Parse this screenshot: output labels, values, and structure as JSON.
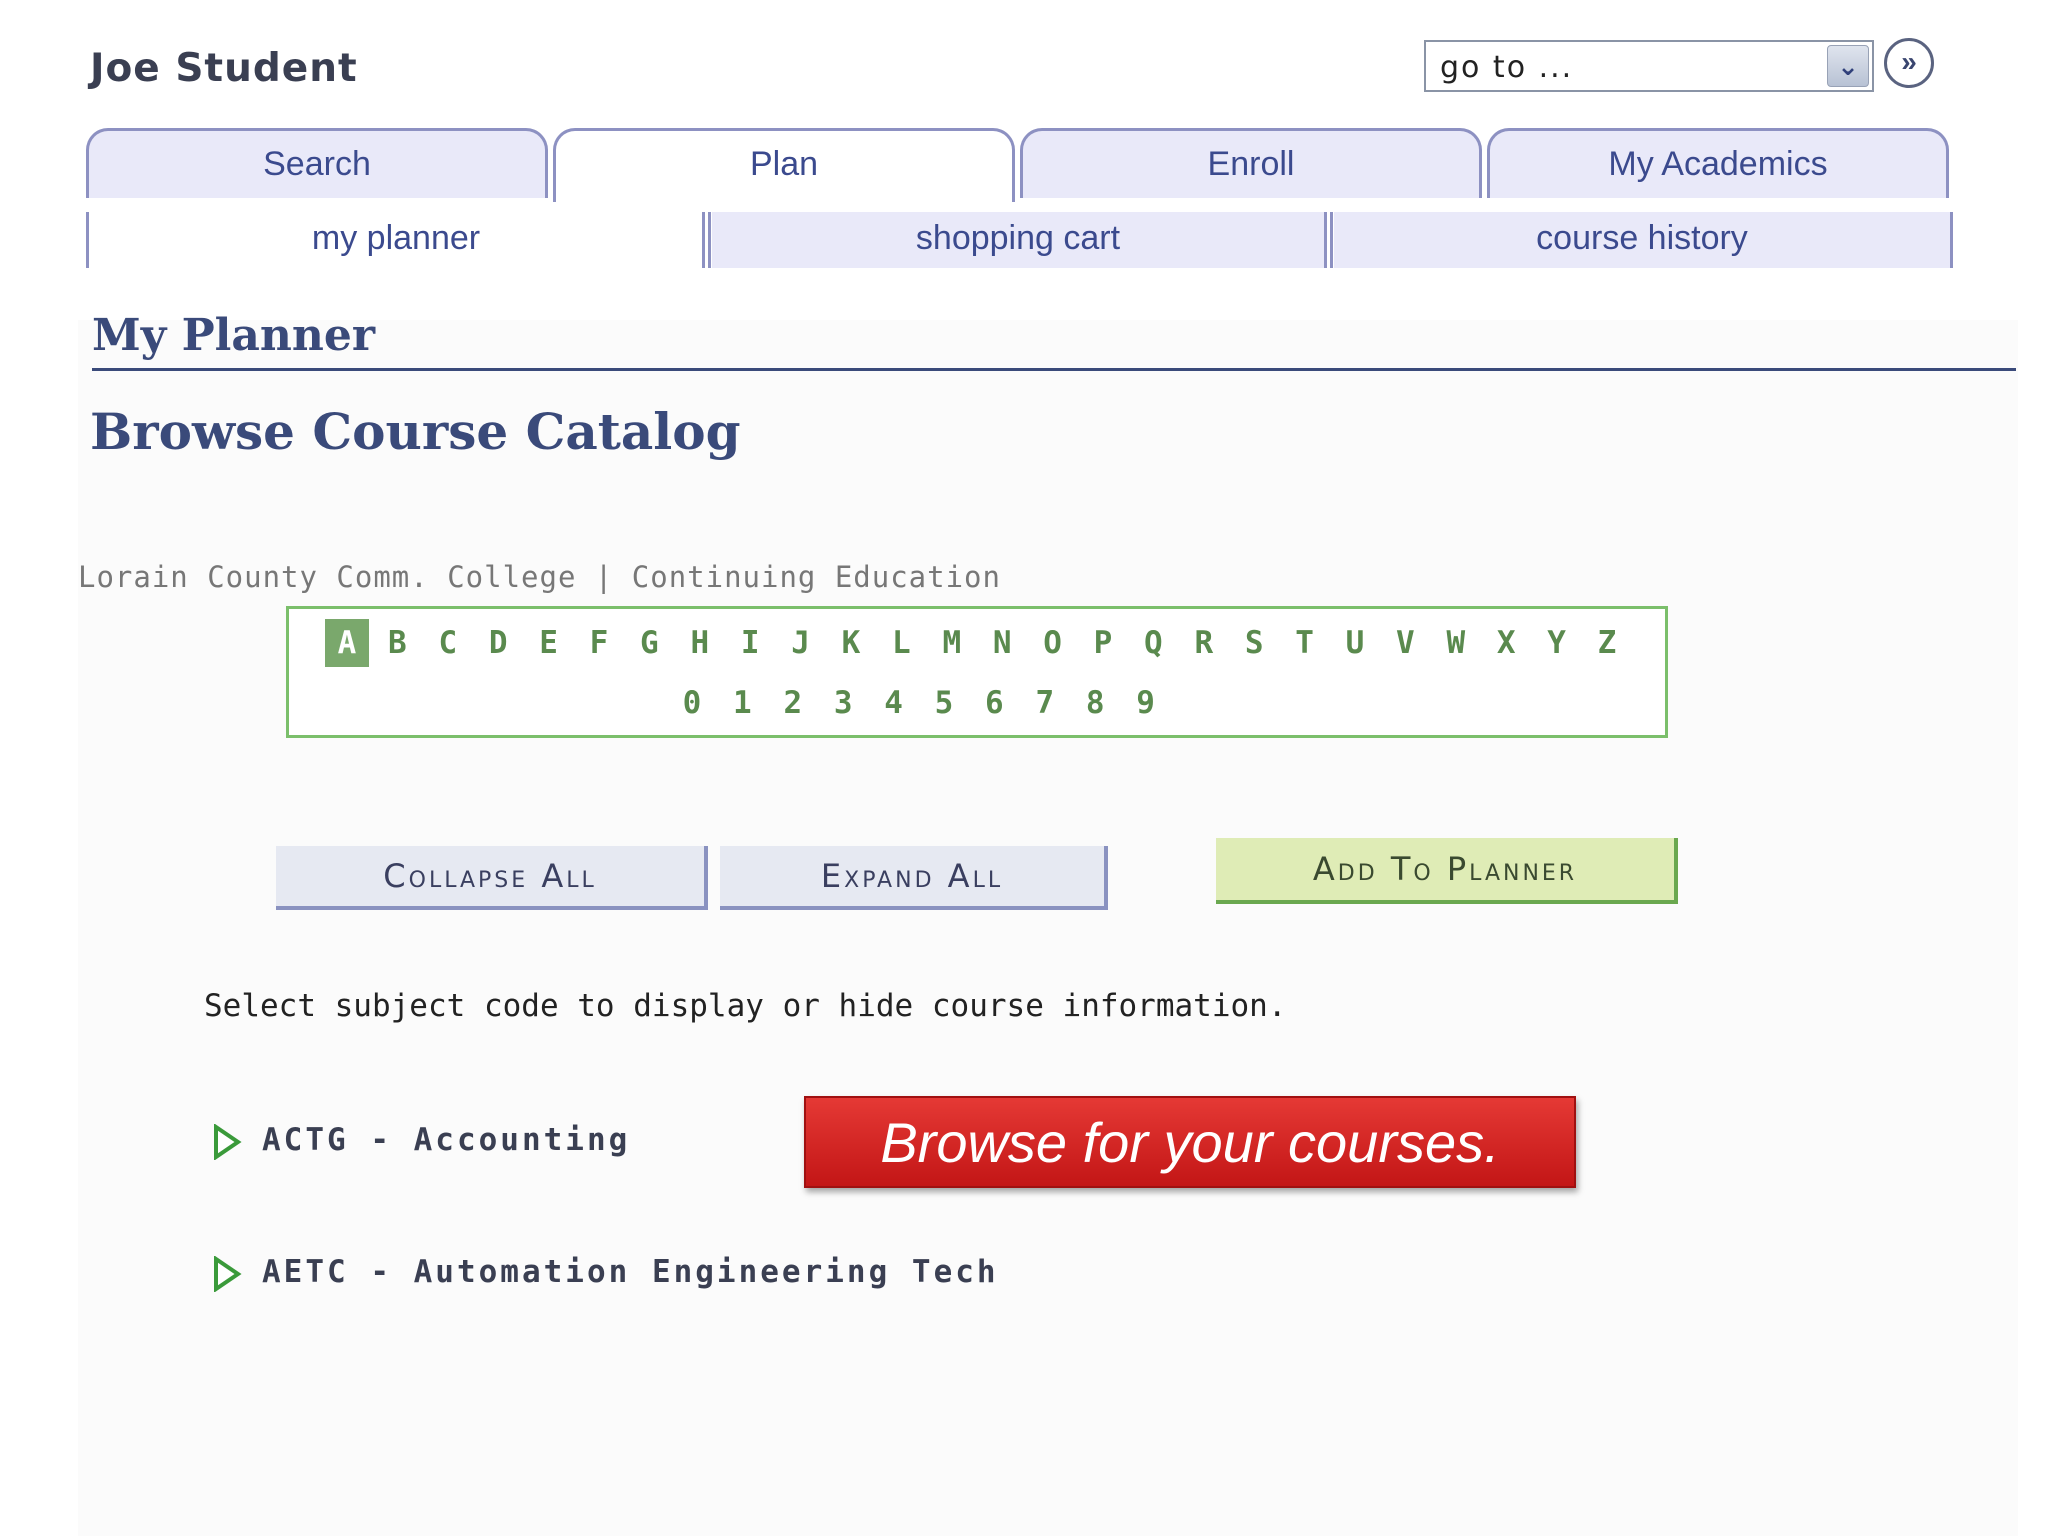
{
  "header": {
    "user_name": "Joe Student",
    "goto_placeholder": "go to ..."
  },
  "tabs": [
    {
      "label": "Search"
    },
    {
      "label": "Plan"
    },
    {
      "label": "Enroll"
    },
    {
      "label": "My Academics"
    }
  ],
  "subtabs": [
    {
      "label": "my planner"
    },
    {
      "label": "shopping cart"
    },
    {
      "label": "course history"
    }
  ],
  "page": {
    "title": "My Planner",
    "subtitle": "Browse Course Catalog",
    "institution": "Lorain County Comm. College | Continuing Education"
  },
  "alphabet": {
    "letters": [
      "A",
      "B",
      "C",
      "D",
      "E",
      "F",
      "G",
      "H",
      "I",
      "J",
      "K",
      "L",
      "M",
      "N",
      "O",
      "P",
      "Q",
      "R",
      "S",
      "T",
      "U",
      "V",
      "W",
      "X",
      "Y",
      "Z"
    ],
    "digits": [
      "0",
      "1",
      "2",
      "3",
      "4",
      "5",
      "6",
      "7",
      "8",
      "9"
    ],
    "selected": "A"
  },
  "buttons": {
    "collapse_all": "Collapse All",
    "expand_all": "Expand All",
    "add_to_planner": "Add To Planner"
  },
  "instruction": "Select subject code to display or hide course information.",
  "subjects": [
    {
      "label": "ACTG - Accounting"
    },
    {
      "label": "AETC - Automation Engineering Tech"
    }
  ],
  "callout": "Browse for your courses.",
  "colors": {
    "tab_border": "#8d91c2",
    "link_blue": "#3b4a8e",
    "alpha_green": "#5a8a4e",
    "callout_red": "#d32020"
  }
}
